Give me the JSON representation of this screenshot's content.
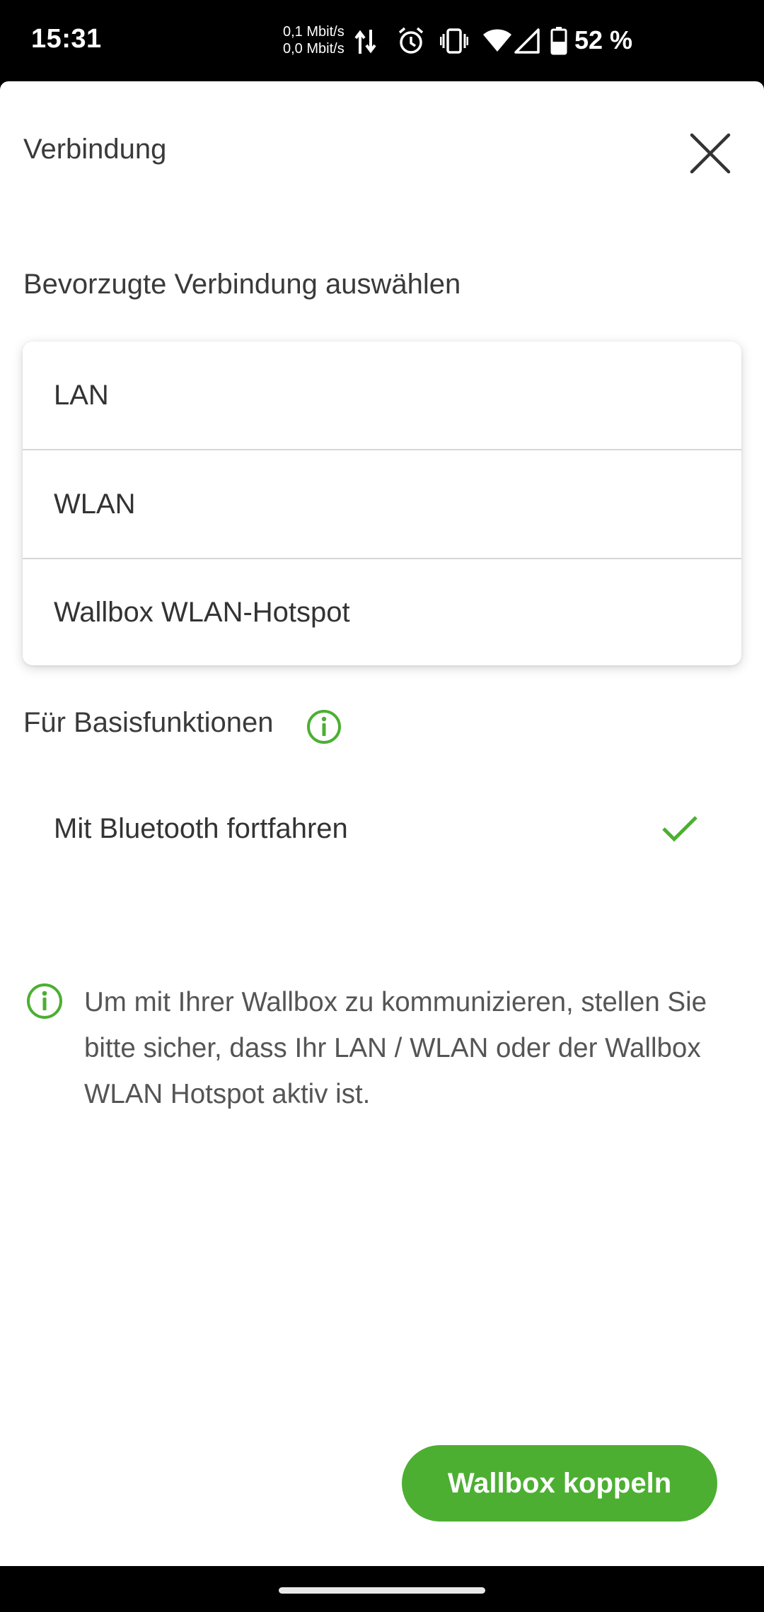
{
  "status_bar": {
    "time": "15:31",
    "net_up": "0,1 Mbit/s",
    "net_down": "0,0 Mbit/s",
    "battery_percent": "52 %",
    "icons": [
      "data-arrows-icon",
      "alarm-icon",
      "vibrate-icon",
      "wifi-icon",
      "signal-icon",
      "battery-icon"
    ]
  },
  "sheet": {
    "title": "Verbindung",
    "close_icon": "close-icon"
  },
  "preferred": {
    "heading": "Bevorzugte Verbindung auswählen",
    "options": [
      {
        "label": "LAN"
      },
      {
        "label": "WLAN"
      },
      {
        "label": "Wallbox WLAN-Hotspot"
      }
    ]
  },
  "basic": {
    "heading": "Für Basisfunktionen",
    "info_icon": "info-icon",
    "bluetooth_label": "Mit Bluetooth fortfahren",
    "bluetooth_selected": true
  },
  "info": {
    "text": "Um mit Ihrer Wallbox zu kommunizieren, stellen Sie bitte sicher, dass Ihr LAN / WLAN oder der Wallbox WLAN Hotspot aktiv ist."
  },
  "actions": {
    "pair_button": "Wallbox koppeln"
  },
  "colors": {
    "accent": "#4caf32",
    "text_primary": "#333333",
    "text_secondary": "#555555",
    "divider": "#d6d6d6"
  }
}
